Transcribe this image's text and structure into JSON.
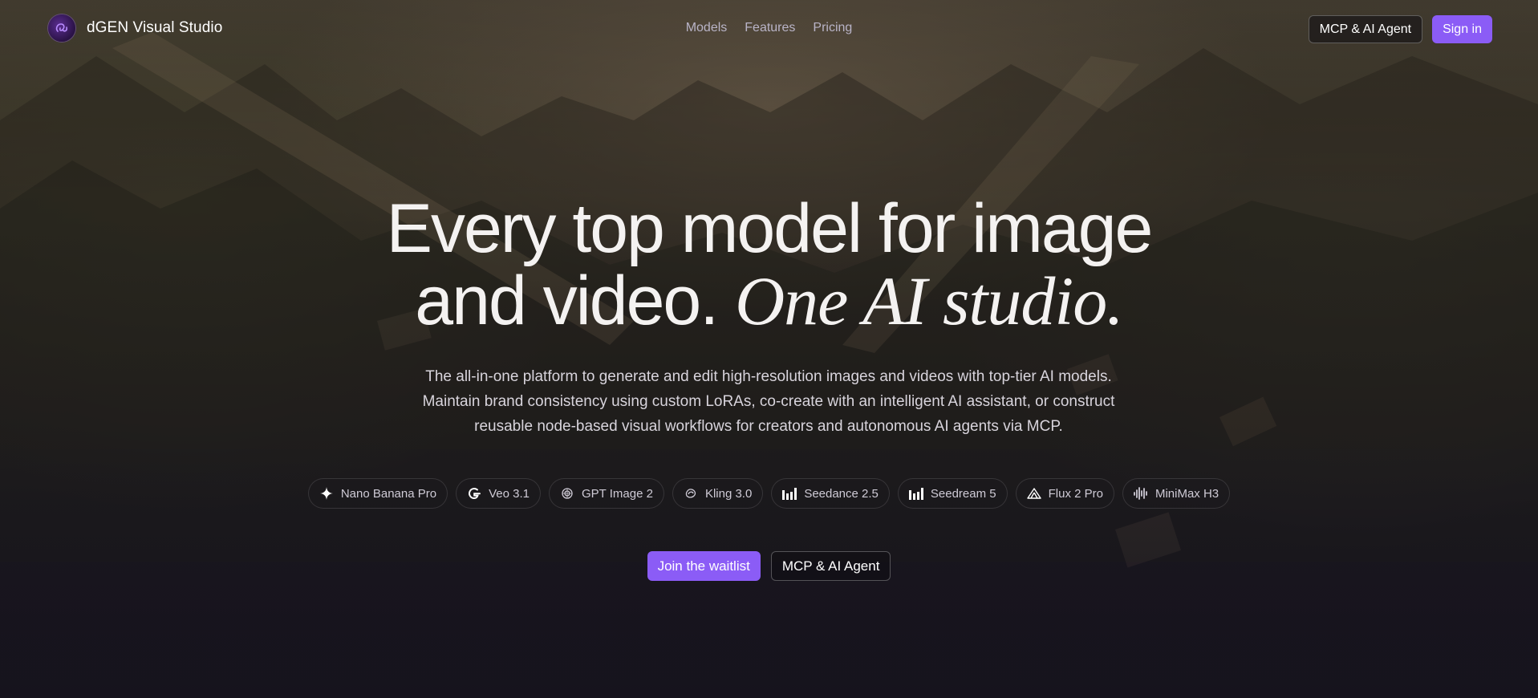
{
  "brand": {
    "name": "dGEN Visual Studio",
    "logo_icon": "dgen-logo-icon"
  },
  "nav": {
    "links": [
      "Models",
      "Features",
      "Pricing"
    ]
  },
  "header_actions": {
    "mcp_label": "MCP & AI Agent",
    "signin_label": "Sign in"
  },
  "hero": {
    "headline_line1": "Every top model for image",
    "headline_line2_plain": "and video.",
    "headline_line2_italic": "One AI studio.",
    "subtext_line1": "The all-in-one platform to generate and edit high-resolution images and videos with top-tier AI models.",
    "subtext_line2": "Maintain brand consistency using custom LoRAs, co-create with an intelligent AI assistant, or construct",
    "subtext_line3": "reusable node-based visual workflows for creators and autonomous AI agents via MCP."
  },
  "models": [
    {
      "label": "Nano Banana Pro",
      "icon": "sparkle-icon"
    },
    {
      "label": "Veo 3.1",
      "icon": "google-g-icon"
    },
    {
      "label": "GPT Image 2",
      "icon": "openai-icon"
    },
    {
      "label": "Kling 3.0",
      "icon": "kling-icon"
    },
    {
      "label": "Seedance 2.5",
      "icon": "bars-icon"
    },
    {
      "label": "Seedream 5",
      "icon": "bars-icon"
    },
    {
      "label": "Flux 2 Pro",
      "icon": "flux-triangle-icon"
    },
    {
      "label": "MiniMax H3",
      "icon": "waveform-icon"
    }
  ],
  "cta": {
    "primary_label": "Join the waitlist",
    "secondary_label": "MCP & AI Agent"
  },
  "colors": {
    "accent": "#8b5cf6",
    "nav_link": "#b9b4c7",
    "background_bottom": "#16131d"
  }
}
